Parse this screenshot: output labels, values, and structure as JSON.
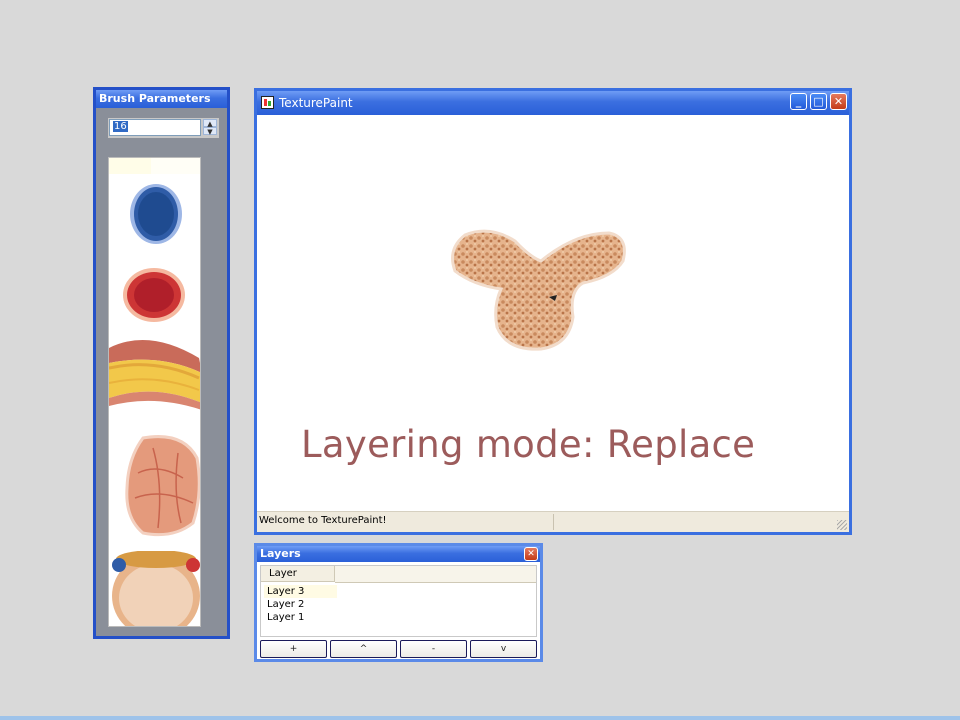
{
  "brush_window": {
    "title": "Brush Parameters",
    "size_value": "16",
    "spinner_up": "▲",
    "spinner_down": "▼"
  },
  "main_window": {
    "title": "TexturePaint",
    "minimize": "_",
    "maximize": "□",
    "close": "✕",
    "overlay_text": "Layering mode: Replace",
    "status_text": "Welcome to TexturePaint!"
  },
  "layers_window": {
    "title": "Layers",
    "close": "✕",
    "column_header": "Layer",
    "rows": [
      "Layer 3",
      "Layer 2",
      "Layer 1"
    ],
    "buttons": [
      "+",
      "^",
      "-",
      "v"
    ]
  }
}
